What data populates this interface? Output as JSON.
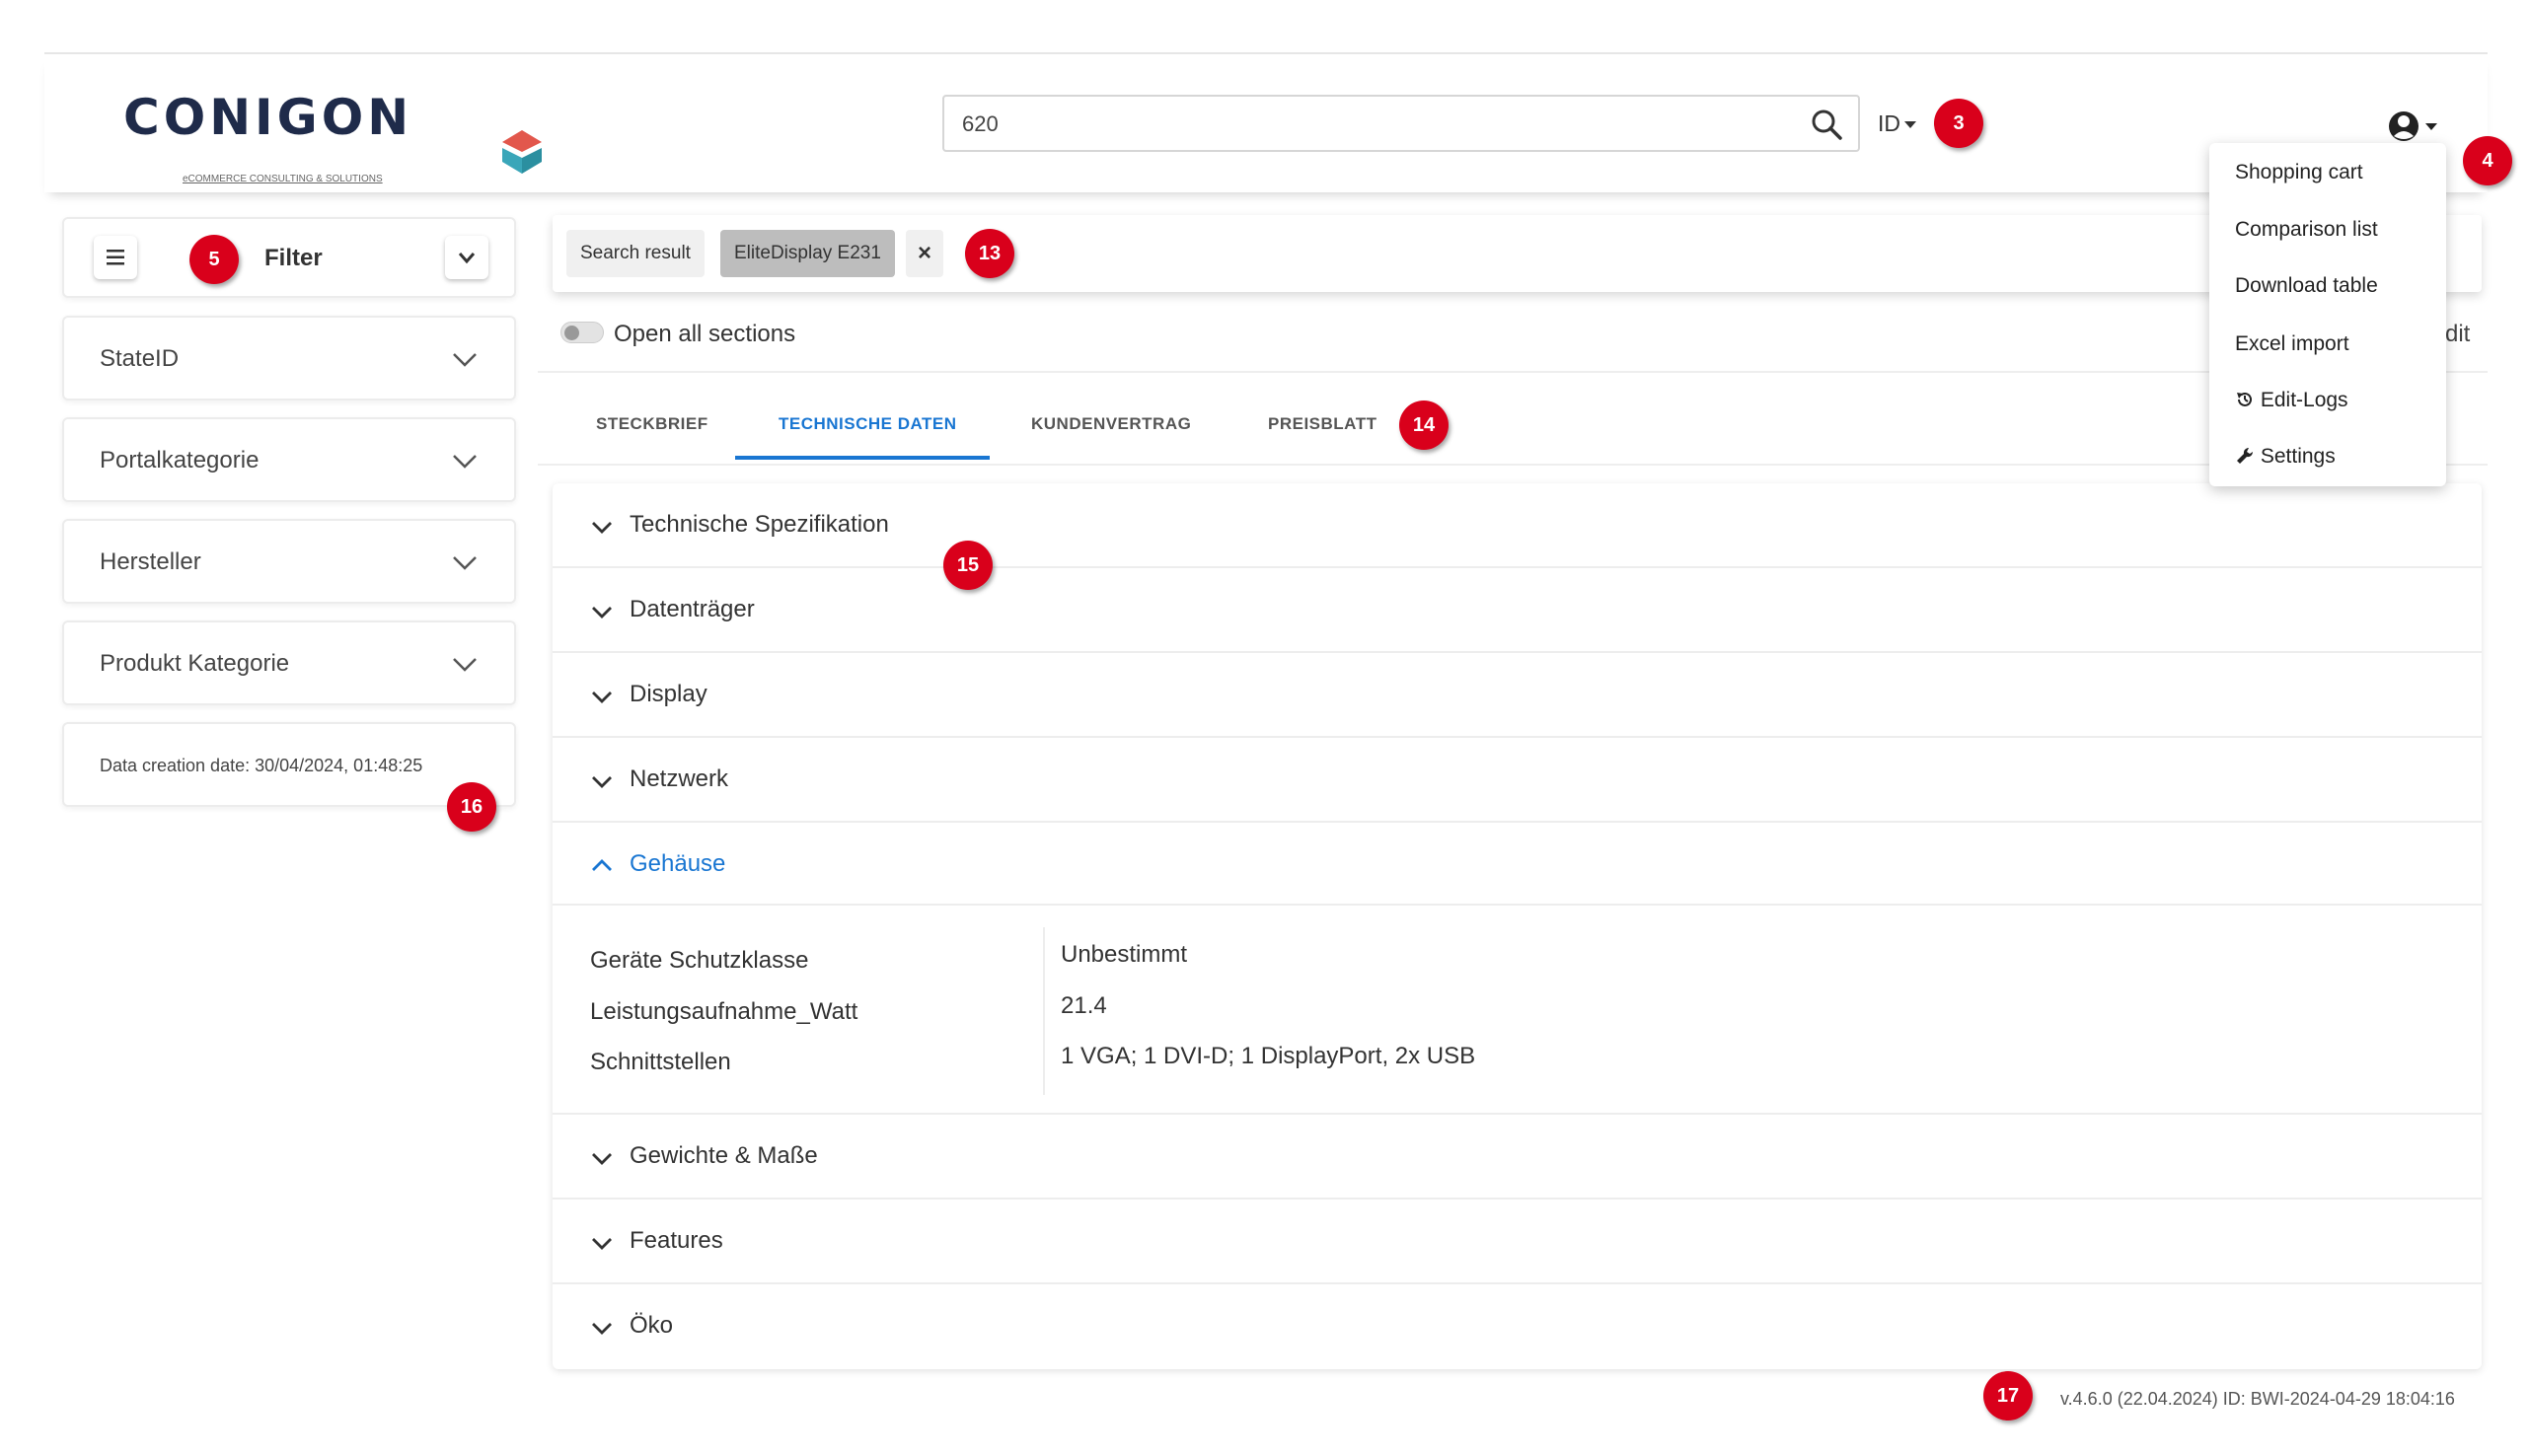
{
  "brand": {
    "name": "CONIGON",
    "tagline": "eCOMMERCE CONSULTING & SOLUTIONS"
  },
  "search": {
    "value": "620",
    "scope_label": "ID"
  },
  "badges": {
    "b3": "3",
    "b4": "4",
    "b5": "5",
    "b13": "13",
    "b14": "14",
    "b15": "15",
    "b16": "16",
    "b17": "17"
  },
  "user_menu": {
    "items": [
      "Shopping cart",
      "Comparison list",
      "Download table",
      "Excel import",
      "Edit-Logs",
      "Settings"
    ]
  },
  "sidebar": {
    "filter_label": "Filter",
    "filters": [
      "StateID",
      "Portalkategorie",
      "Hersteller",
      "Produkt Kategorie"
    ],
    "data_creation": "Data creation date: 30/04/2024, 01:48:25"
  },
  "breadcrumb": {
    "search_result": "Search result",
    "active_chip": "EliteDisplay E231",
    "close": "×"
  },
  "toolbar": {
    "open_all": "Open all sections",
    "edit_partial": "dit"
  },
  "tabs": [
    "STECKBRIEF",
    "TECHNISCHE DATEN",
    "KUNDENVERTRAG",
    "PREISBLATT"
  ],
  "active_tab": "TECHNISCHE DATEN",
  "sections": {
    "before": [
      "Technische Spezifikation",
      "Datenträger",
      "Display",
      "Netzwerk"
    ],
    "open": "Gehäuse",
    "after": [
      "Gewichte & Maße",
      "Features",
      "Öko"
    ]
  },
  "specs": [
    {
      "key": "Geräte Schutzklasse",
      "value": "Unbestimmt"
    },
    {
      "key": "Leistungsaufnahme_Watt",
      "value": "21.4"
    },
    {
      "key": "Schnittstellen",
      "value": "1 VGA; 1 DVI-D; 1 DisplayPort, 2x USB"
    }
  ],
  "footer": {
    "version": "v.4.6.0 (22.04.2024) ID: BWI-2024-04-29 18:04:16"
  },
  "colors": {
    "accent": "#1976d2",
    "badge": "#d9001b",
    "logo_dark": "#1f2b4a",
    "logo_red": "#e2574c",
    "logo_teal": "#3aa6b9"
  }
}
